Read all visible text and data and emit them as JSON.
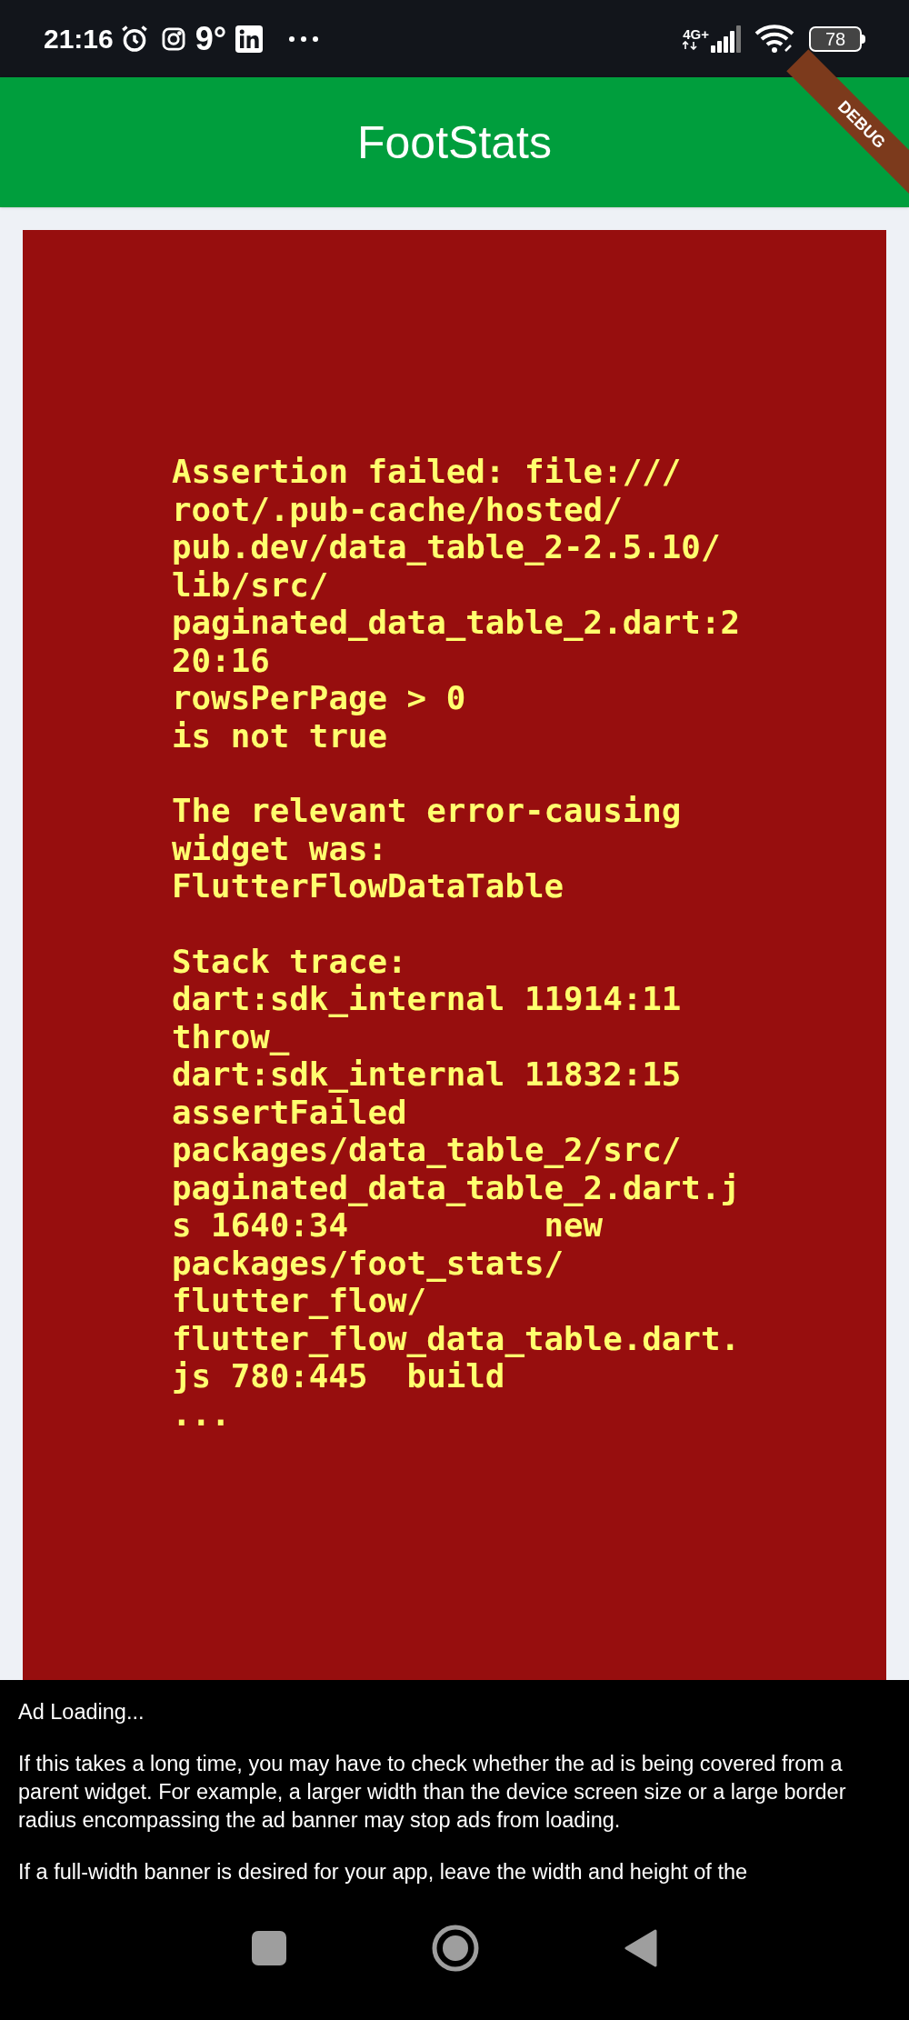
{
  "status_bar": {
    "time": "21:16",
    "weather": "9°",
    "network": "4G+",
    "battery": "78"
  },
  "app_bar": {
    "title": "FootStats",
    "debug_banner": "DEBUG"
  },
  "error": {
    "paragraphs": [
      [
        "Assertion failed: file:///",
        "root/.pub-cache/hosted/",
        "pub.dev/data_table_2-2.5.10/",
        "lib/src/",
        "paginated_data_table_2.dart:2",
        "20:16",
        "rowsPerPage > 0",
        "is not true"
      ],
      [
        "The relevant error-causing",
        "widget was:",
        "FlutterFlowDataTable"
      ],
      [
        "Stack trace:",
        "dart:sdk_internal 11914:11",
        "throw_",
        "dart:sdk_internal 11832:15",
        "assertFailed",
        "packages/data_table_2/src/",
        "paginated_data_table_2.dart.j",
        "s 1640:34          new",
        "packages/foot_stats/",
        "flutter_flow/",
        "flutter_flow_data_table.dart.",
        "js 780:445  build",
        "..."
      ]
    ]
  },
  "ad_banner": {
    "paragraphs": [
      "Ad Loading...",
      "If this takes a long time, you may have to check whether the ad is being covered from a parent widget. For example, a larger width than the device screen size or a large border radius encompassing the ad banner may stop ads from loading.",
      "If a full-width banner is desired for your app, leave the width and height of the"
    ]
  }
}
